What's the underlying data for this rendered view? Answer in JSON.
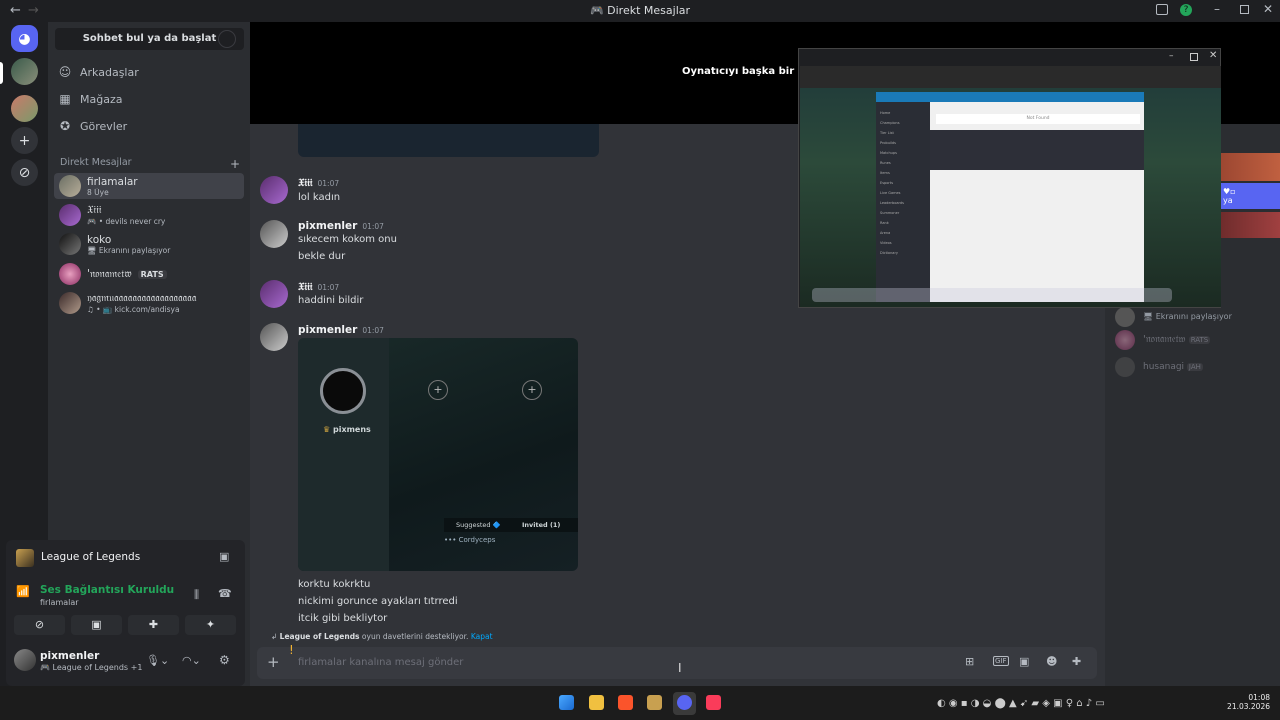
{
  "window": {
    "title": "Direkt Mesajlar"
  },
  "colors": {
    "discord": "#5865f2",
    "green": "#23a55a",
    "red": "#f23f43",
    "link": "#00a8fc",
    "gold": "#f0b232"
  },
  "dm_column": {
    "search_placeholder": "Sohbet bul ya da başlat",
    "nav": [
      {
        "label": "Arkadaşlar",
        "icon": "friends-icon"
      },
      {
        "label": "Mağaza",
        "icon": "shop-icon"
      },
      {
        "label": "Görevler",
        "icon": "quests-icon"
      }
    ],
    "dm_header": "Direkt Mesajlar",
    "dm_add": "+",
    "dms": [
      {
        "name": "firlamalar",
        "sub": "8 Üye"
      },
      {
        "name": "𝔛𝔦𝔦𝔦",
        "sub": "🎮 • devils never cry"
      },
      {
        "name": "koko",
        "sub": "🖥 Ekranını paylaşıyor"
      },
      {
        "name": "'𝔫𝔬𝔫𝔞𝔪𝔢𝔱𝔴",
        "sub": "",
        "tag": "RATS"
      },
      {
        "name": "𝔶𝔞𝔤𝔪𝔲𝔞𝔞𝔞𝔞𝔞𝔞𝔞𝔞𝔞𝔞𝔞𝔞𝔞𝔞𝔞𝔞𝔞𝔞",
        "sub": "♫ • 📺 kick.com/andisya"
      }
    ]
  },
  "voice": {
    "activity": "League of Legends",
    "status": "Ses Bağlantısı Kuruldu",
    "channel": "firlamalar",
    "user": "pixmenler",
    "user_sub": "🎮 League of Legends +1"
  },
  "stream": {
    "overlay_text": "Oynatıcıyı başka bir pence"
  },
  "messages": [
    {
      "author": "𝔛𝔦𝔦𝔦",
      "time": "01:07",
      "lines": [
        "lol kadın"
      ]
    },
    {
      "author": "pixmenler",
      "time": "01:07",
      "lines": [
        "sıkecem kokom onu",
        "bekle dur"
      ]
    },
    {
      "author": "𝔛𝔦𝔦𝔦",
      "time": "01:07",
      "lines": [
        "haddini bildir"
      ]
    },
    {
      "author": "pixmenler",
      "time": "01:07",
      "lines": [
        "korktu kokrktu",
        "nickimi gorunce ayakları tıtrredi",
        "itcik gibi bekliytor"
      ]
    }
  ],
  "embed": {
    "player": "pixmens",
    "tab1": "Suggested 🔷",
    "tab2": "Invited (1)",
    "suggested": "Cordyceps"
  },
  "invite_note": {
    "game": "League of Legends",
    "text": " oyun davetlerini destekliyor.",
    "link": "Kapat"
  },
  "input": {
    "placeholder": "firlamalar kanalına mesaj gönder"
  },
  "popup": {
    "page_title": "Not Found",
    "menu": [
      "Home",
      "Champions",
      "Tier List",
      "Probuilds",
      "Matchups",
      "Runes",
      "Items",
      "Esports",
      "Live Games",
      "Leaderboards",
      "Summoner",
      "Rank",
      "Arena",
      "Videos",
      "Dictionary"
    ]
  },
  "right_members": [
    {
      "name": "",
      "sub": "🖥 Ekranını paylaşıyor"
    },
    {
      "name": "'𝔫𝔬𝔫𝔞𝔪𝔢𝔱𝔴",
      "tag": "RATS"
    },
    {
      "name": "husanagi",
      "tag": "JAH"
    }
  ],
  "taskbar": {
    "time": "01:08",
    "date": "21.03.2026"
  }
}
